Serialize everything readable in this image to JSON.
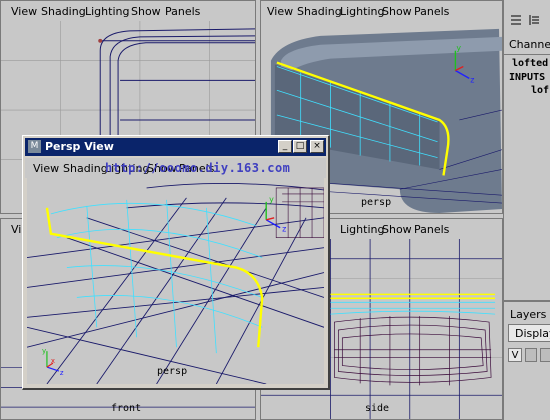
{
  "menus": [
    "View",
    "Shading",
    "Lighting",
    "Show",
    "Panels"
  ],
  "floating_window": {
    "title": "Persp View",
    "menus": [
      "View",
      "Shading",
      "Lighting",
      "Show",
      "Panels"
    ],
    "watermark": "http://ooomo.diy.163.com",
    "camera_label": "persp"
  },
  "viewports": {
    "top_right_label": "persp",
    "bottom_left_label": "front",
    "bottom_right_label": "side"
  },
  "channel_box": {
    "tab": "Channels",
    "object_name": "lofted",
    "inputs_label": "INPUTS",
    "input_item": "lof"
  },
  "layers": {
    "tab": "Layers",
    "display_option": "Display",
    "visibility_flag": "V"
  },
  "colors": {
    "panel_bg": "#c8c8c8",
    "viewport_bg": "#c8c8c8",
    "wire_dark": "#1a1a6a",
    "wire_cyan": "#40e0ff",
    "highlight_yellow": "#ffff00",
    "title_bar": "#0a246a"
  }
}
